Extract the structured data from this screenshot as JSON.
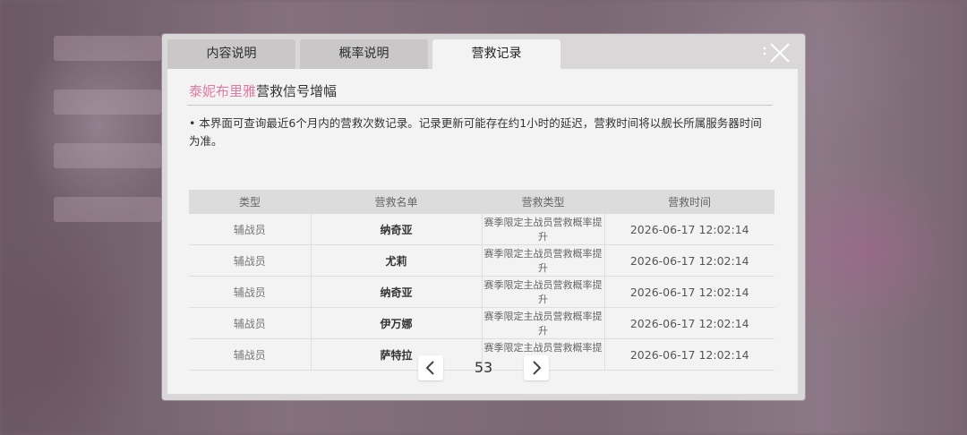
{
  "tabs": [
    {
      "label": "内容说明"
    },
    {
      "label": "概率说明"
    },
    {
      "label": "营救记录"
    }
  ],
  "active_tab": "营救记录",
  "heading": {
    "highlight": "泰妮布里雅",
    "rest": "营救信号增幅"
  },
  "description": "• 本界面可查询最近6个月内的营救次数记录。记录更新可能存在约1小时的延迟，营救时间将以舰长所属服务器时间为准。",
  "table": {
    "headers": [
      "类型",
      "营救名单",
      "营救类型",
      "营救时间"
    ],
    "rows": [
      {
        "type": "辅战员",
        "name": "纳奇亚",
        "rescue_type": "赛季限定主战员营救概率提升",
        "time": "2026-06-17 12:02:14"
      },
      {
        "type": "辅战员",
        "name": "尤莉",
        "rescue_type": "赛季限定主战员营救概率提升",
        "time": "2026-06-17 12:02:14"
      },
      {
        "type": "辅战员",
        "name": "纳奇亚",
        "rescue_type": "赛季限定主战员营救概率提升",
        "time": "2026-06-17 12:02:14"
      },
      {
        "type": "辅战员",
        "name": "伊万娜",
        "rescue_type": "赛季限定主战员营救概率提升",
        "time": "2026-06-17 12:02:14"
      },
      {
        "type": "辅战员",
        "name": "萨特拉",
        "rescue_type": "赛季限定主战员营救概率提升",
        "time": "2026-06-17 12:02:14"
      }
    ]
  },
  "pagination": {
    "page": "53"
  },
  "icons": {
    "close": "close-icon",
    "prev": "chevron-left-icon",
    "next": "chevron-right-icon"
  },
  "colors": {
    "accent_pink": "#e07aa0",
    "panel": "#f3f3f3"
  }
}
